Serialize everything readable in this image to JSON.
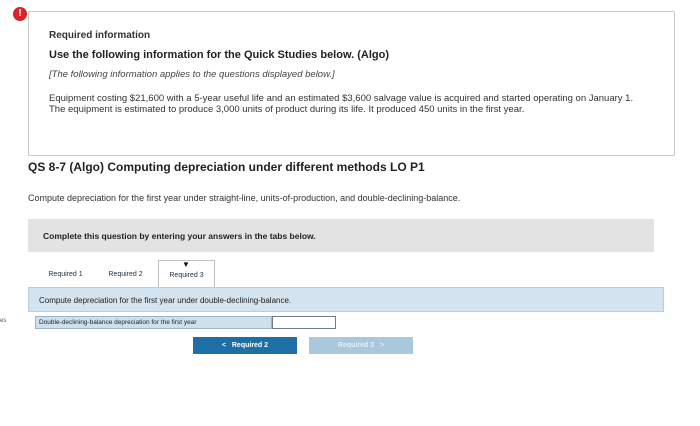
{
  "alert": {
    "icon": "alert-icon",
    "glyph": "!"
  },
  "edge_mark": "es",
  "info": {
    "title": "Required information",
    "heading": "Use the following information for the Quick Studies below. (Algo)",
    "note": "[The following information applies to the questions displayed below.]",
    "body": "Equipment costing $21,600 with a 5-year useful life and an estimated $3,600 salvage value is acquired and started operating on January 1. The equipment is estimated to produce 3,000 units of product during its life. It produced 450 units in the first year."
  },
  "question": {
    "title": "QS 8-7 (Algo) Computing depreciation under different methods LO P1",
    "prompt": "Compute depreciation for the first year under straight-line, units-of-production, and double-declining-balance.",
    "instruction": "Complete this question by entering your answers in the tabs below."
  },
  "tabs": [
    {
      "label": "Required 1",
      "active": false
    },
    {
      "label": "Required 2",
      "active": false
    },
    {
      "label": "Required 3",
      "active": true
    }
  ],
  "panel": {
    "text": "Compute depreciation for the first year under double-declining-balance.",
    "answer_label": "Double-declining-balance depreciation for the first year",
    "answer_value": ""
  },
  "nav": {
    "prev_label": "Required 2",
    "next_label": "Required 3",
    "prev_glyph": "<",
    "next_glyph": ">"
  },
  "colors": {
    "alert": "#d8232a",
    "primary_button": "#1d6fa5",
    "disabled_button": "#a9c8dd",
    "panel_bg": "#d3e3ef"
  }
}
